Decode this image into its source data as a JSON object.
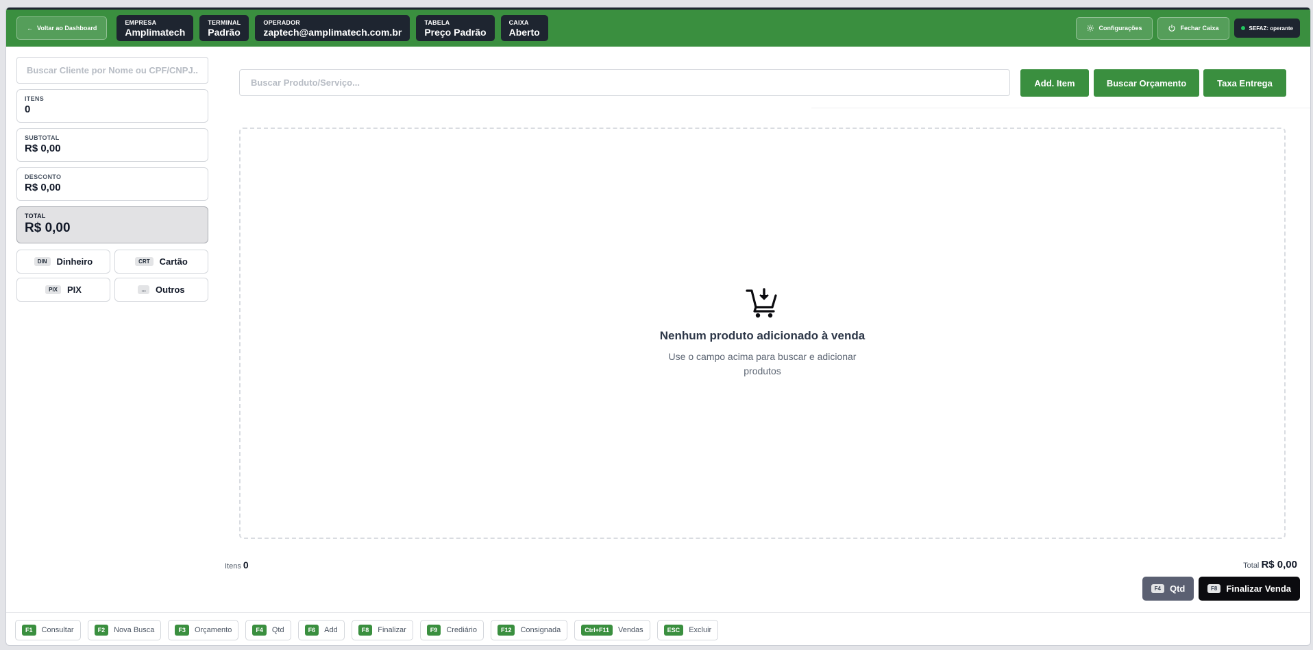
{
  "header": {
    "back_label": "Voltar ao Dashboard",
    "info": [
      {
        "label": "EMPRESA",
        "value": "Amplimatech"
      },
      {
        "label": "TERMINAL",
        "value": "Padrão"
      },
      {
        "label": "OPERADOR",
        "value": "zaptech@amplimatech.com.br"
      },
      {
        "label": "TABELA",
        "value": "Preço Padrão"
      },
      {
        "label": "CAIXA",
        "value": "Aberto"
      }
    ],
    "config_label": "Configurações",
    "close_label": "Fechar Caixa",
    "sefaz_label": "SEFAZ: operante"
  },
  "left": {
    "client_placeholder": "Buscar Cliente por Nome ou CPF/CNPJ...",
    "itens_label": "ITENS",
    "itens_value": "0",
    "subtotal_label": "SUBTOTAL",
    "subtotal_value": "R$ 0,00",
    "desconto_label": "DESCONTO",
    "desconto_value": "R$ 0,00",
    "total_label": "TOTAL",
    "total_value": "R$ 0,00",
    "payments": [
      {
        "tag": "DIN",
        "label": "Dinheiro"
      },
      {
        "tag": "CRT",
        "label": "Cartão"
      },
      {
        "tag": "PIX",
        "label": "PIX"
      },
      {
        "tag": "...",
        "label": "Outros"
      }
    ]
  },
  "main": {
    "product_placeholder": "Buscar Produto/Serviço...",
    "add_item": "Add. Item",
    "buscar_orcamento": "Buscar Orçamento",
    "taxa_entrega": "Taxa Entrega",
    "empty_title": "Nenhum produto adicionado à venda",
    "empty_sub": "Use o campo acima para buscar e adicionar produtos",
    "footer_items_label": "Itens",
    "footer_items_value": "0",
    "footer_total_label": "Total",
    "footer_total_value": "R$ 0,00",
    "qty_key": "F4",
    "qty_label": "Qtd",
    "finalize_key": "F8",
    "finalize_label": "Finalizar Venda"
  },
  "shortcuts": [
    {
      "key": "F1",
      "label": "Consultar"
    },
    {
      "key": "F2",
      "label": "Nova Busca"
    },
    {
      "key": "F3",
      "label": "Orçamento"
    },
    {
      "key": "F4",
      "label": "Qtd"
    },
    {
      "key": "F6",
      "label": "Add"
    },
    {
      "key": "F8",
      "label": "Finalizar"
    },
    {
      "key": "F9",
      "label": "Crediário"
    },
    {
      "key": "F12",
      "label": "Consignada"
    },
    {
      "key": "Ctrl+F11",
      "label": "Vendas"
    },
    {
      "key": "ESC",
      "label": "Excluir"
    }
  ],
  "colors": {
    "header_green": "#3a8f3f",
    "dark_pill": "#1e2530",
    "status_dot": "#22c55e"
  }
}
